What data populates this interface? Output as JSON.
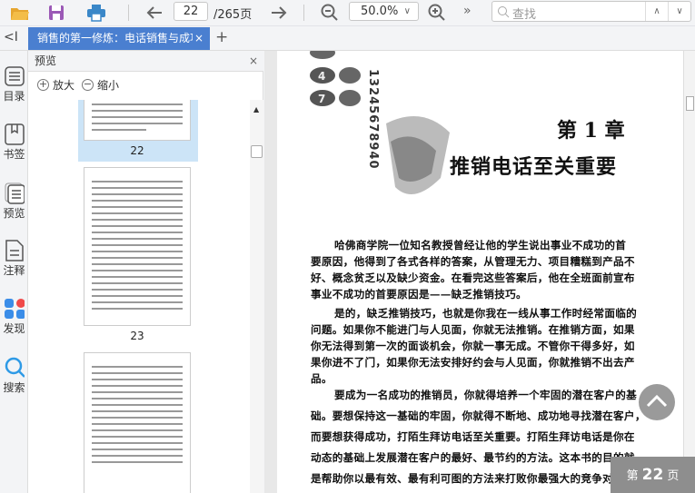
{
  "toolbar": {
    "page_current": "22",
    "page_total": "/265页",
    "zoom": "50.0%",
    "more": "»",
    "search_placeholder": "查找",
    "up": "∧",
    "down": "∨"
  },
  "tabs": {
    "collapse": "<I",
    "doc_title": "销售的第一修炼：电话销售与成功",
    "close": "×",
    "new_tab": "+"
  },
  "rail": [
    {
      "label": "目录"
    },
    {
      "label": "书签"
    },
    {
      "label": "预览"
    },
    {
      "label": "注释"
    },
    {
      "label": "发现"
    },
    {
      "label": "搜索"
    }
  ],
  "preview": {
    "title": "预览",
    "close": "×",
    "zoom_in": "放大",
    "zoom_out": "缩小",
    "zoom_in_glyph": "+",
    "zoom_out_glyph": "−",
    "thumbnails": [
      {
        "label": "22"
      },
      {
        "label": "23"
      }
    ]
  },
  "page": {
    "chapter_number": "第 1 章",
    "chapter_title": "推销电话至关重要",
    "keypad": [
      "4",
      "7",
      "13245678940"
    ],
    "paragraphs": [
      {
        "lines": [
          "哈佛商学院一位知名教授曾经让他的学生说出事业不成功的首",
          "要原因，他得到了各式各样的答案，从管理无力、项目糟糕到产品不",
          "好、概念贫乏以及缺少资金。在看完这些答案后，他在全班面前宣布",
          "事业不成功的首要原因是——缺乏推销技巧。"
        ]
      },
      {
        "lines": [
          "是的，缺乏推销技巧，也就是你我在一线从事工作时经常面临的",
          "问题。如果你不能进门与人见面，你就无法推销。在推销方面，如果",
          "你无法得到第一次的面谈机会，你就一事无成。不管你干得多好，如",
          "果你进不了门，如果你无法安排好约会与人见面，你就推销不出去产",
          "品。"
        ]
      },
      {
        "lines": [
          "要成为一名成功的推销员，你就得培养一个牢固的潜在客户的基",
          "础。要想保持这一基础的牢固，你就得不断地、成功地寻找潜在客户，",
          "而要想获得成功，打陌生拜访电话至关重要。打陌生拜访电话是你在",
          "动态的基础上发展潜在客户的最好、最节约的方法。这本书的目的就",
          "是帮助你以最有效、最有利可图的方法来打败你最强大的竞争对手。"
        ]
      }
    ]
  },
  "page_indicator": {
    "prefix": "第",
    "number": "22",
    "suffix": "页"
  },
  "colors": {
    "accent": "#4a7fd0",
    "thumb_selected": "#cce4f7"
  }
}
